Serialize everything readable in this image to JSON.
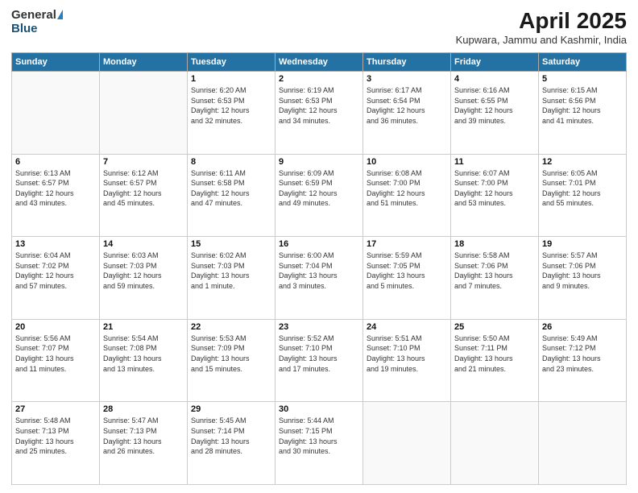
{
  "header": {
    "logo_general": "General",
    "logo_blue": "Blue",
    "title": "April 2025",
    "location": "Kupwara, Jammu and Kashmir, India"
  },
  "columns": [
    "Sunday",
    "Monday",
    "Tuesday",
    "Wednesday",
    "Thursday",
    "Friday",
    "Saturday"
  ],
  "weeks": [
    [
      {
        "day": "",
        "detail": ""
      },
      {
        "day": "",
        "detail": ""
      },
      {
        "day": "1",
        "detail": "Sunrise: 6:20 AM\nSunset: 6:53 PM\nDaylight: 12 hours\nand 32 minutes."
      },
      {
        "day": "2",
        "detail": "Sunrise: 6:19 AM\nSunset: 6:53 PM\nDaylight: 12 hours\nand 34 minutes."
      },
      {
        "day": "3",
        "detail": "Sunrise: 6:17 AM\nSunset: 6:54 PM\nDaylight: 12 hours\nand 36 minutes."
      },
      {
        "day": "4",
        "detail": "Sunrise: 6:16 AM\nSunset: 6:55 PM\nDaylight: 12 hours\nand 39 minutes."
      },
      {
        "day": "5",
        "detail": "Sunrise: 6:15 AM\nSunset: 6:56 PM\nDaylight: 12 hours\nand 41 minutes."
      }
    ],
    [
      {
        "day": "6",
        "detail": "Sunrise: 6:13 AM\nSunset: 6:57 PM\nDaylight: 12 hours\nand 43 minutes."
      },
      {
        "day": "7",
        "detail": "Sunrise: 6:12 AM\nSunset: 6:57 PM\nDaylight: 12 hours\nand 45 minutes."
      },
      {
        "day": "8",
        "detail": "Sunrise: 6:11 AM\nSunset: 6:58 PM\nDaylight: 12 hours\nand 47 minutes."
      },
      {
        "day": "9",
        "detail": "Sunrise: 6:09 AM\nSunset: 6:59 PM\nDaylight: 12 hours\nand 49 minutes."
      },
      {
        "day": "10",
        "detail": "Sunrise: 6:08 AM\nSunset: 7:00 PM\nDaylight: 12 hours\nand 51 minutes."
      },
      {
        "day": "11",
        "detail": "Sunrise: 6:07 AM\nSunset: 7:00 PM\nDaylight: 12 hours\nand 53 minutes."
      },
      {
        "day": "12",
        "detail": "Sunrise: 6:05 AM\nSunset: 7:01 PM\nDaylight: 12 hours\nand 55 minutes."
      }
    ],
    [
      {
        "day": "13",
        "detail": "Sunrise: 6:04 AM\nSunset: 7:02 PM\nDaylight: 12 hours\nand 57 minutes."
      },
      {
        "day": "14",
        "detail": "Sunrise: 6:03 AM\nSunset: 7:03 PM\nDaylight: 12 hours\nand 59 minutes."
      },
      {
        "day": "15",
        "detail": "Sunrise: 6:02 AM\nSunset: 7:03 PM\nDaylight: 13 hours\nand 1 minute."
      },
      {
        "day": "16",
        "detail": "Sunrise: 6:00 AM\nSunset: 7:04 PM\nDaylight: 13 hours\nand 3 minutes."
      },
      {
        "day": "17",
        "detail": "Sunrise: 5:59 AM\nSunset: 7:05 PM\nDaylight: 13 hours\nand 5 minutes."
      },
      {
        "day": "18",
        "detail": "Sunrise: 5:58 AM\nSunset: 7:06 PM\nDaylight: 13 hours\nand 7 minutes."
      },
      {
        "day": "19",
        "detail": "Sunrise: 5:57 AM\nSunset: 7:06 PM\nDaylight: 13 hours\nand 9 minutes."
      }
    ],
    [
      {
        "day": "20",
        "detail": "Sunrise: 5:56 AM\nSunset: 7:07 PM\nDaylight: 13 hours\nand 11 minutes."
      },
      {
        "day": "21",
        "detail": "Sunrise: 5:54 AM\nSunset: 7:08 PM\nDaylight: 13 hours\nand 13 minutes."
      },
      {
        "day": "22",
        "detail": "Sunrise: 5:53 AM\nSunset: 7:09 PM\nDaylight: 13 hours\nand 15 minutes."
      },
      {
        "day": "23",
        "detail": "Sunrise: 5:52 AM\nSunset: 7:10 PM\nDaylight: 13 hours\nand 17 minutes."
      },
      {
        "day": "24",
        "detail": "Sunrise: 5:51 AM\nSunset: 7:10 PM\nDaylight: 13 hours\nand 19 minutes."
      },
      {
        "day": "25",
        "detail": "Sunrise: 5:50 AM\nSunset: 7:11 PM\nDaylight: 13 hours\nand 21 minutes."
      },
      {
        "day": "26",
        "detail": "Sunrise: 5:49 AM\nSunset: 7:12 PM\nDaylight: 13 hours\nand 23 minutes."
      }
    ],
    [
      {
        "day": "27",
        "detail": "Sunrise: 5:48 AM\nSunset: 7:13 PM\nDaylight: 13 hours\nand 25 minutes."
      },
      {
        "day": "28",
        "detail": "Sunrise: 5:47 AM\nSunset: 7:13 PM\nDaylight: 13 hours\nand 26 minutes."
      },
      {
        "day": "29",
        "detail": "Sunrise: 5:45 AM\nSunset: 7:14 PM\nDaylight: 13 hours\nand 28 minutes."
      },
      {
        "day": "30",
        "detail": "Sunrise: 5:44 AM\nSunset: 7:15 PM\nDaylight: 13 hours\nand 30 minutes."
      },
      {
        "day": "",
        "detail": ""
      },
      {
        "day": "",
        "detail": ""
      },
      {
        "day": "",
        "detail": ""
      }
    ]
  ]
}
